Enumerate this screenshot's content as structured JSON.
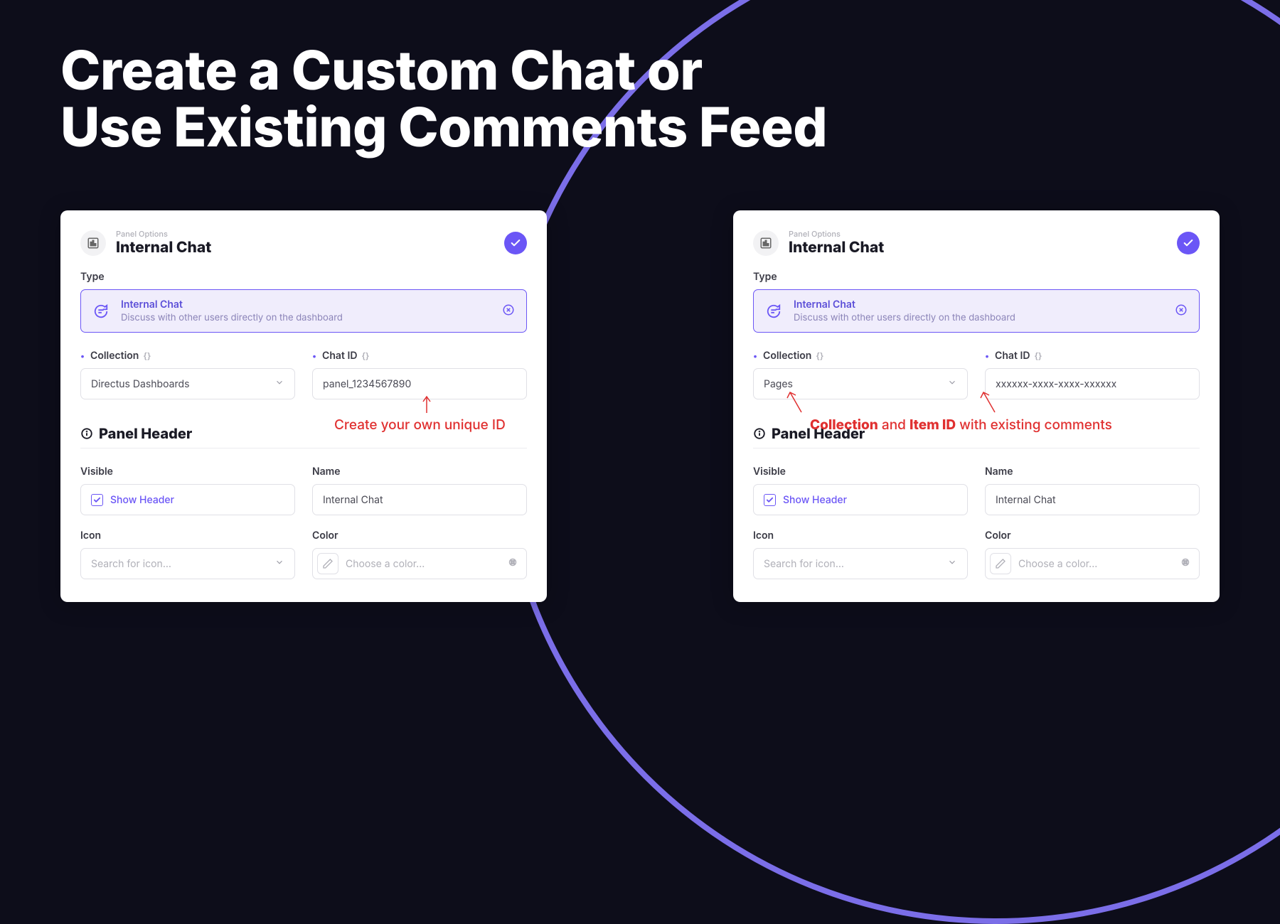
{
  "heading_line1": "Create a Custom Chat or",
  "heading_line2": "Use Existing Comments Feed",
  "left": {
    "eyebrow": "Panel Options",
    "title": "Internal Chat",
    "type_label": "Type",
    "type_card_title": "Internal Chat",
    "type_card_desc": "Discuss with other users directly on the dashboard",
    "collection_label": "Collection",
    "collection_value": "Directus Dashboards",
    "chatid_label": "Chat ID",
    "chatid_value": "panel_1234567890",
    "panel_header_label": "Panel Header",
    "visible_label": "Visible",
    "show_header_label": "Show Header",
    "name_label": "Name",
    "name_value": "Internal Chat",
    "icon_label": "Icon",
    "icon_placeholder": "Search for icon...",
    "color_label": "Color",
    "color_placeholder": "Choose a color...",
    "annotation": "Create your own unique ID"
  },
  "right": {
    "eyebrow": "Panel Options",
    "title": "Internal Chat",
    "type_label": "Type",
    "type_card_title": "Internal Chat",
    "type_card_desc": "Discuss with other users directly on the dashboard",
    "collection_label": "Collection",
    "collection_value": "Pages",
    "chatid_label": "Chat ID",
    "chatid_value": "xxxxxx-xxxx-xxxx-xxxxxx",
    "panel_header_label": "Panel Header",
    "visible_label": "Visible",
    "show_header_label": "Show Header",
    "name_label": "Name",
    "name_value": "Internal Chat",
    "icon_label": "Icon",
    "icon_placeholder": "Search for icon...",
    "color_label": "Color",
    "color_placeholder": "Choose a color...",
    "annotation_collection": "Collection",
    "annotation_and": " and ",
    "annotation_itemid": "Item ID",
    "annotation_tail": " with existing comments"
  }
}
